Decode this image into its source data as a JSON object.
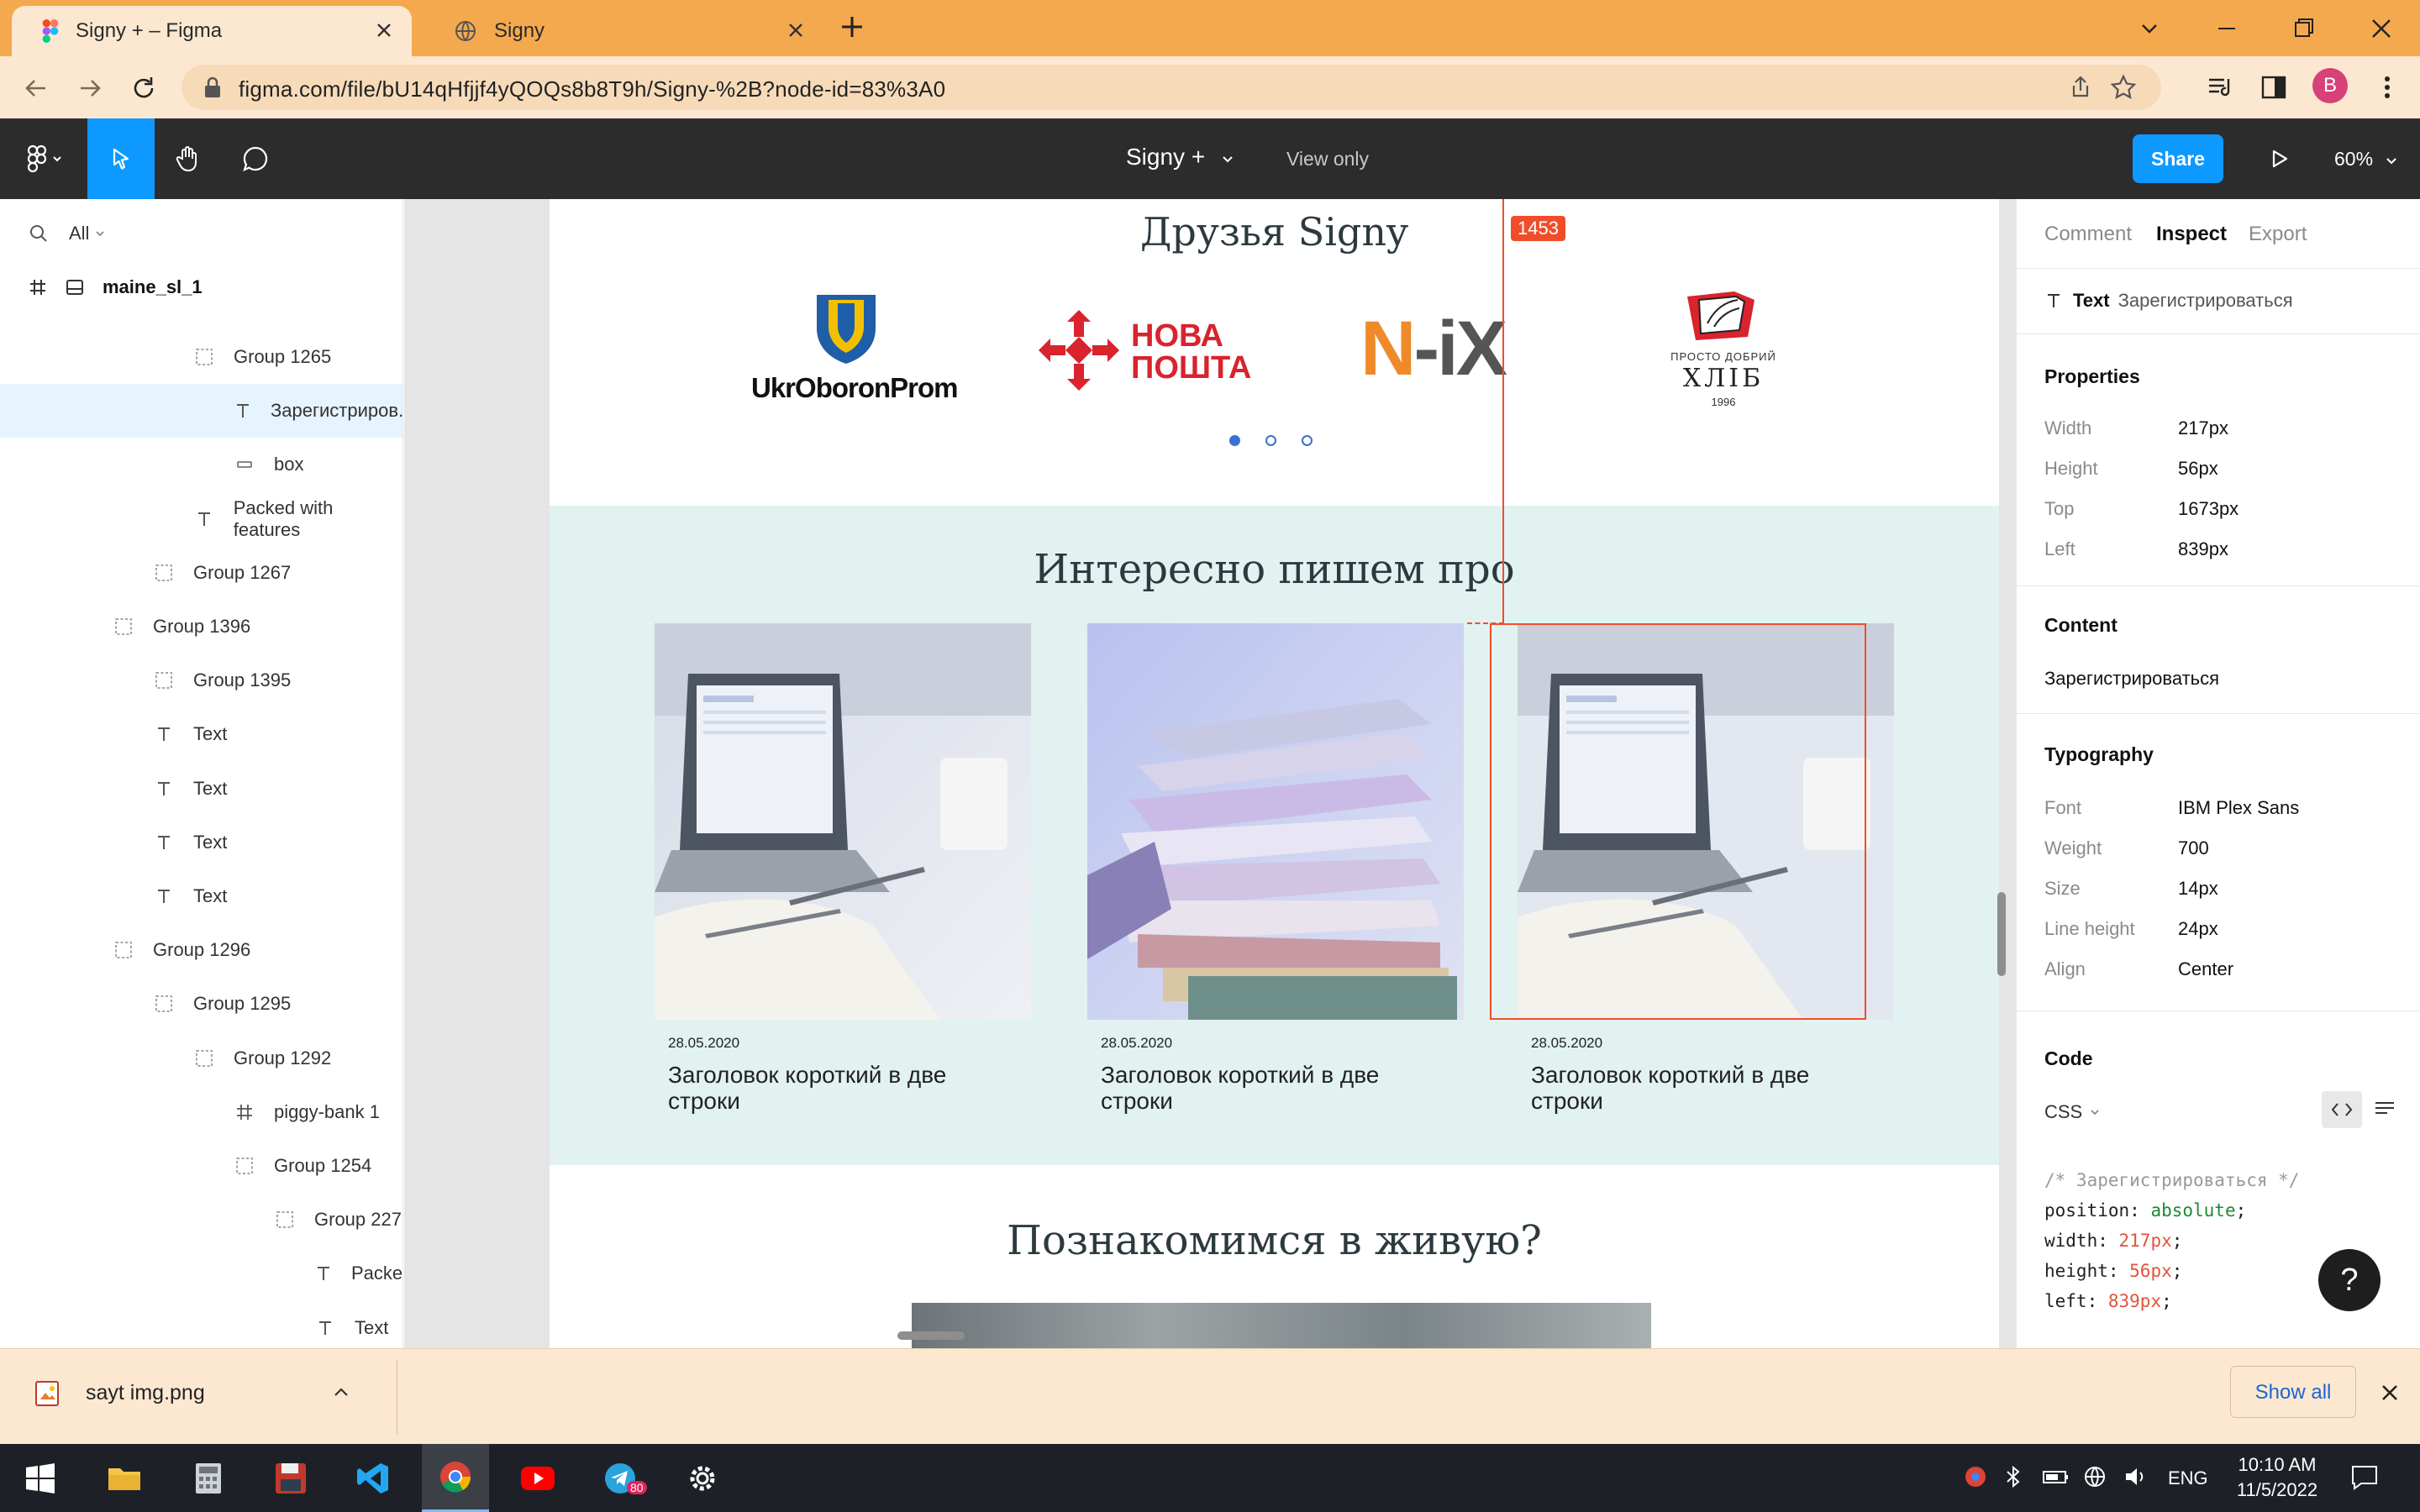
{
  "browser": {
    "tabs": [
      {
        "title": "Signy + – Figma",
        "active": true
      },
      {
        "title": "Signy",
        "active": false
      }
    ],
    "url": "figma.com/file/bU14qHfjjf4yQOQs8b8T9h/Signy-%2B?node-id=83%3A0",
    "profile_initial": "B"
  },
  "figma": {
    "file_name": "Signy +",
    "view_mode": "View only",
    "share_label": "Share",
    "zoom": "60%"
  },
  "layers": {
    "filter": "All",
    "page": "maine_sl_1",
    "items": [
      {
        "name": "Group 1265",
        "type": "group",
        "indent": 3,
        "selected": false
      },
      {
        "name": "Зарегистриров...",
        "type": "text",
        "indent": 4,
        "selected": true
      },
      {
        "name": "box",
        "type": "rect",
        "indent": 4,
        "selected": false
      },
      {
        "name": "Packed with features",
        "type": "text",
        "indent": 3,
        "selected": false
      },
      {
        "name": "Group 1267",
        "type": "group",
        "indent": 2,
        "selected": false
      },
      {
        "name": "Group 1396",
        "type": "group",
        "indent": 1,
        "selected": false
      },
      {
        "name": "Group 1395",
        "type": "group",
        "indent": 2,
        "selected": false
      },
      {
        "name": "Text",
        "type": "text",
        "indent": 2,
        "selected": false
      },
      {
        "name": "Text",
        "type": "text",
        "indent": 2,
        "selected": false
      },
      {
        "name": "Text",
        "type": "text",
        "indent": 2,
        "selected": false
      },
      {
        "name": "Text",
        "type": "text",
        "indent": 2,
        "selected": false
      },
      {
        "name": "Group 1296",
        "type": "group",
        "indent": 1,
        "selected": false
      },
      {
        "name": "Group 1295",
        "type": "group",
        "indent": 2,
        "selected": false
      },
      {
        "name": "Group 1292",
        "type": "group",
        "indent": 3,
        "selected": false
      },
      {
        "name": "piggy-bank 1",
        "type": "frame",
        "indent": 4,
        "selected": false
      },
      {
        "name": "Group 1254",
        "type": "group",
        "indent": 4,
        "selected": false
      },
      {
        "name": "Group 227",
        "type": "group",
        "indent": 5,
        "selected": false
      },
      {
        "name": "Packed...",
        "type": "text",
        "indent": 6,
        "selected": false
      },
      {
        "name": "Text",
        "type": "text",
        "indent": 6,
        "selected": false
      }
    ]
  },
  "canvas": {
    "friends_title": "Друзья Signy",
    "logos": {
      "ukroboronprom": "UkrOboronProm",
      "nova_line1": "НОВА",
      "nova_line2": "ПОШТА",
      "nix_n": "N",
      "nix_rest": "-iX",
      "khlib_top": "ПРОСТО ДОБРИЙ",
      "khlib_main": "ХЛІБ",
      "khlib_year": "1996"
    },
    "blog_title": "Интересно пишем про",
    "cards": [
      {
        "date": "28.05.2020",
        "title": "Заголовок короткий в две строки",
        "image": "laptop-desk"
      },
      {
        "date": "28.05.2020",
        "title": "Заголовок короткий в две строки",
        "image": "paper-stack"
      },
      {
        "date": "28.05.2020",
        "title": "Заголовок короткий в две строки",
        "image": "laptop-desk"
      }
    ],
    "meet_title": "Познакомимся в живую?",
    "measurement": "1453"
  },
  "inspect": {
    "tabs": [
      "Comment",
      "Inspect",
      "Export"
    ],
    "layer_type": "Text",
    "layer_name": "Зарегистрироваться",
    "properties_title": "Properties",
    "properties": [
      {
        "label": "Width",
        "value": "217px"
      },
      {
        "label": "Height",
        "value": "56px"
      },
      {
        "label": "Top",
        "value": "1673px"
      },
      {
        "label": "Left",
        "value": "839px"
      }
    ],
    "content_title": "Content",
    "content": "Зарегистрироваться",
    "typography_title": "Typography",
    "typography": [
      {
        "label": "Font",
        "value": "IBM Plex Sans"
      },
      {
        "label": "Weight",
        "value": "700"
      },
      {
        "label": "Size",
        "value": "14px"
      },
      {
        "label": "Line height",
        "value": "24px"
      },
      {
        "label": "Align",
        "value": "Center"
      }
    ],
    "code_title": "Code",
    "code_lang": "CSS",
    "code_comment": "/* Зарегистрироваться */",
    "code_lines": [
      {
        "prop": "position",
        "value": "absolute",
        "kind": "kw"
      },
      {
        "prop": "width",
        "value": "217px",
        "kind": "num"
      },
      {
        "prop": "height",
        "value": "56px",
        "kind": "num"
      },
      {
        "prop": "left",
        "value": "839px",
        "kind": "num"
      }
    ],
    "help": "?"
  },
  "download_bar": {
    "file": "sayt img.png",
    "show_all": "Show all"
  },
  "taskbar": {
    "lang": "ENG",
    "time": "10:10 AM",
    "date": "11/5/2022",
    "telegram_badge": "80"
  },
  "colors": {
    "accent": "#0d99ff",
    "tabbar": "#f4a94e",
    "measure": "#f04e2b",
    "blog_bg": "#e1f2f0"
  }
}
